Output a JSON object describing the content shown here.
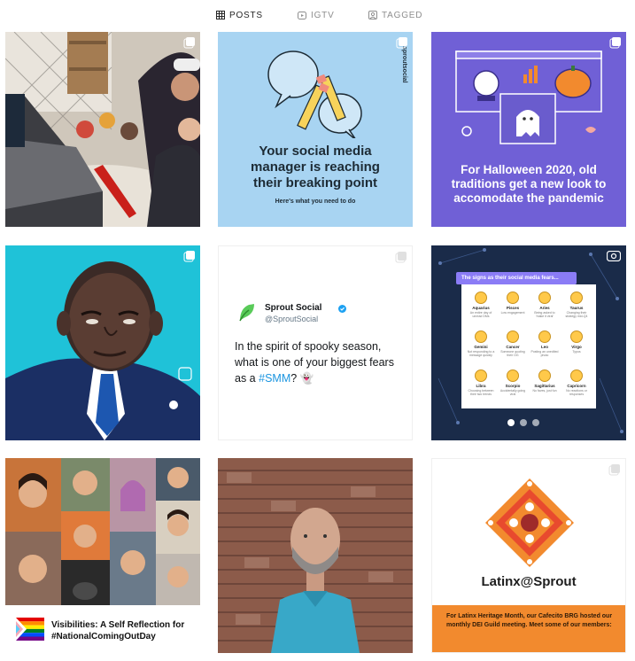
{
  "tabs": [
    {
      "label": "POSTS",
      "icon": "grid-icon",
      "active": true
    },
    {
      "label": "IGTV",
      "icon": "igtv-icon",
      "active": false
    },
    {
      "label": "TAGGED",
      "icon": "tagged-icon",
      "active": false
    }
  ],
  "posts": {
    "p2": {
      "title": "Your social media manager is reaching their breaking point",
      "subtitle": "Here's what you need to do",
      "brand": "sproutsocial"
    },
    "p3": {
      "title": "For Halloween 2020, old traditions get a new look to accomodate the pandemic"
    },
    "p5": {
      "name": "Sprout Social",
      "handle": "@SproutSocial",
      "text": "In the spirit of spooky season, what is one of your biggest fears as a",
      "hashtag": "#SMM",
      "after": "? 👻"
    },
    "p6": {
      "header": "The signs as their social media fears...",
      "signs": [
        {
          "name": "Aquarius",
          "desc": "An entire day of unread DMs"
        },
        {
          "name": "Pisces",
          "desc": "Low engagement"
        },
        {
          "name": "Aries",
          "desc": "Being asked to 'make it viral'"
        },
        {
          "name": "Taurus",
          "desc": "Changing their strategy mid-Q4"
        },
        {
          "name": "Gemini",
          "desc": "Not responding to a message quickly"
        },
        {
          "name": "Cancer",
          "desc": "Someone quoting their OG"
        },
        {
          "name": "Leo",
          "desc": "Posting an unedited photo"
        },
        {
          "name": "Virgo",
          "desc": "Typos"
        },
        {
          "name": "Libra",
          "desc": "Choosing between their two trends"
        },
        {
          "name": "Scorpio",
          "desc": "Accidentally going viral"
        },
        {
          "name": "Sagittarius",
          "desc": "No faves, just fun"
        },
        {
          "name": "Capricorn",
          "desc": "No reactions or responses"
        }
      ]
    },
    "p7": {
      "caption": "Visibilities: A Self Reflection for #NationalComingOutDay"
    },
    "p9": {
      "title": "Latinx@Sprout",
      "band": "For Latinx Heritage Month, our Cafecito BRG hosted our monthly DEI Guild meeting. Meet some of our members:"
    }
  },
  "colors": {
    "accent": "#1b95e0",
    "instagram_text": "#262626",
    "muted": "#8e8e8e"
  }
}
